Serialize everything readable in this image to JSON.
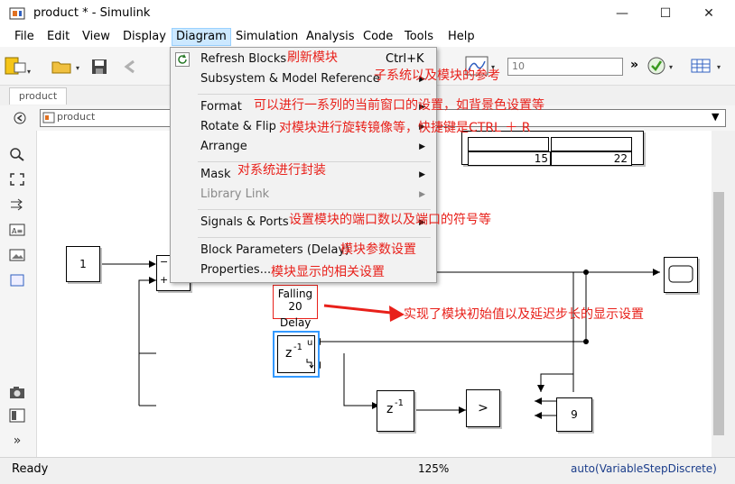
{
  "window": {
    "title": "product * - Simulink",
    "controls": [
      "minimize",
      "maximize",
      "close"
    ]
  },
  "menubar": {
    "items": [
      "File",
      "Edit",
      "View",
      "Display",
      "Diagram",
      "Simulation",
      "Analysis",
      "Code",
      "Tools",
      "Help"
    ],
    "active": "Diagram"
  },
  "toolbar": {
    "sim_time_value": "10"
  },
  "tabs": {
    "active_tab": "product"
  },
  "address": {
    "path": "product"
  },
  "diagram_menu": {
    "items": [
      {
        "label": "Refresh Blocks",
        "shortcut": "Ctrl+K",
        "annotation": "刷新模块"
      },
      {
        "label": "Subsystem & Model Reference",
        "annotation": "子系统以及模块的参考"
      },
      {
        "label": "Format",
        "annotation": "可以进行一系列的当前窗口的设置，如背景色设置等"
      },
      {
        "label": "Rotate & Flip",
        "annotation": "对模块进行旋转镜像等，快捷键是CTRL ＋ R"
      },
      {
        "label": "Arrange"
      },
      {
        "label": "Mask",
        "annotation": "对系统进行封装"
      },
      {
        "label": "Library Link"
      },
      {
        "label": "Signals & Ports",
        "annotation": "设置模块的端口数以及端口的符号等"
      },
      {
        "label": "Block Parameters (Delay)",
        "annotation": "模块参数设置"
      },
      {
        "label": "Properties...",
        "annotation": "模块显示的相关设置"
      }
    ]
  },
  "canvas": {
    "display_values": [
      "15",
      "22"
    ],
    "constant_1": "1",
    "constant_9": "9",
    "sum_signs": [
      "−",
      "+"
    ],
    "delay_label": "Delay",
    "delay_symbol": "z",
    "delay_exponent": "-1",
    "delay_port_u": "u",
    "unit_delay_symbol": "z",
    "unit_delay_exponent": "-1",
    "relational_op": ">",
    "falling_label": "Falling",
    "falling_value": "20",
    "delay_annotation": "实现了模块初始值以及延迟步长的显示设置"
  },
  "statusbar": {
    "status": "Ready",
    "zoom": "125%",
    "solver": "auto(VariableStepDiscrete)"
  },
  "colors": {
    "annotation_red": "#e8201a",
    "menu_highlight": "#cce8ff",
    "selected_block_border": "#3399ff",
    "solver_text": "#1a3c8a"
  }
}
